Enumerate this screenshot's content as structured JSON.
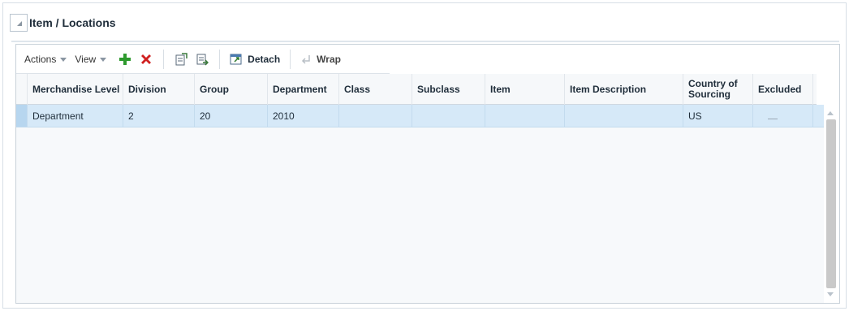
{
  "section": {
    "title": "Item / Locations"
  },
  "toolbar": {
    "actions_label": "Actions",
    "view_label": "View",
    "add_icon": "plus-icon",
    "delete_icon": "x-icon",
    "detach_label": "Detach",
    "wrap_label": "Wrap",
    "colors": {
      "add": "#2e9a2e",
      "delete": "#d02020"
    }
  },
  "table": {
    "columns": [
      {
        "label": "Merchandise Level"
      },
      {
        "label": "Division"
      },
      {
        "label": "Group"
      },
      {
        "label": "Department"
      },
      {
        "label": "Class"
      },
      {
        "label": "Subclass"
      },
      {
        "label": "Item"
      },
      {
        "label": "Item Description"
      },
      {
        "label": "Country of Sourcing"
      },
      {
        "label": "Excluded"
      }
    ],
    "rows": [
      {
        "merchandise_level": "Department",
        "division": "2",
        "group": "20",
        "department": "2010",
        "class": "",
        "subclass": "",
        "item": "",
        "item_description": "",
        "country_of_sourcing": "US",
        "excluded": ""
      }
    ],
    "selected_row_color": "#d6e9f8"
  }
}
